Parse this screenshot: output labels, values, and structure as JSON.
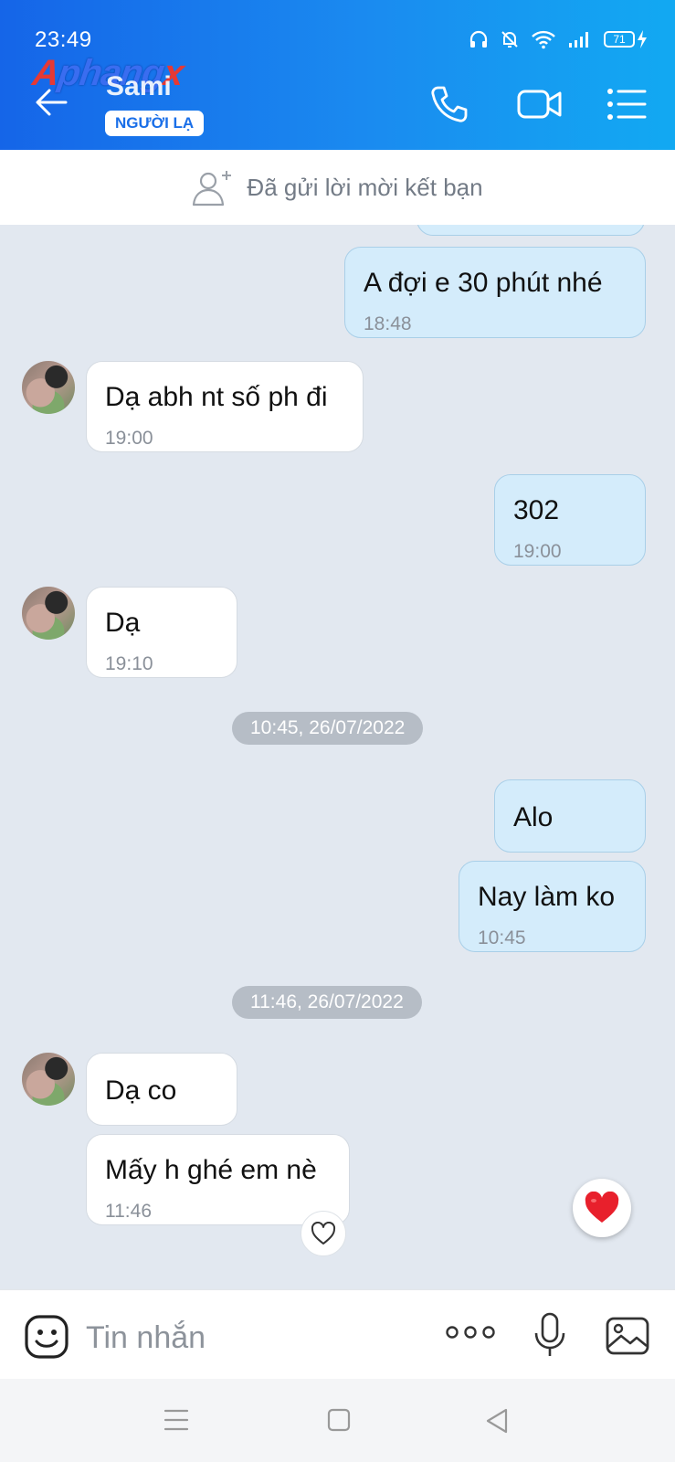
{
  "status_bar": {
    "time": "23:49",
    "battery": "71"
  },
  "watermark": {
    "part1": "A",
    "part2": "phang",
    "part3": "x"
  },
  "header": {
    "contact_name": "Sami",
    "badge": "NGƯỜI LẠ",
    "icons": [
      "back-arrow-icon",
      "phone-icon",
      "video-icon",
      "menu-icon"
    ]
  },
  "friend_request": {
    "text": "Đã gửi lời mời kết bạn"
  },
  "messages": [
    {
      "dir": "out",
      "text": "A đợi e 30 phút nhé",
      "time": "18:48"
    },
    {
      "dir": "in",
      "text": "Dạ abh nt số ph đi",
      "time": "19:00"
    },
    {
      "dir": "out",
      "text": "302",
      "time": "19:00"
    },
    {
      "dir": "in",
      "text": "Dạ",
      "time": "19:10"
    },
    {
      "dir": "out",
      "text": "Alo",
      "time": ""
    },
    {
      "dir": "out",
      "text": "Nay làm ko",
      "time": "10:45"
    },
    {
      "dir": "in",
      "text": "Dạ co",
      "time": ""
    },
    {
      "dir": "in",
      "text": "Mấy h ghé em nè",
      "time": "11:46"
    }
  ],
  "date_separators": [
    "10:45, 26/07/2022",
    "11:46, 26/07/2022"
  ],
  "input": {
    "placeholder": "Tin nhắn"
  },
  "colors": {
    "header_start": "#1565e8",
    "header_end": "#12a9f2",
    "outgoing_bubble": "#d4ecfb",
    "incoming_bubble": "#ffffff",
    "chat_bg": "#e2e8f0",
    "heart": "#e8202c"
  }
}
